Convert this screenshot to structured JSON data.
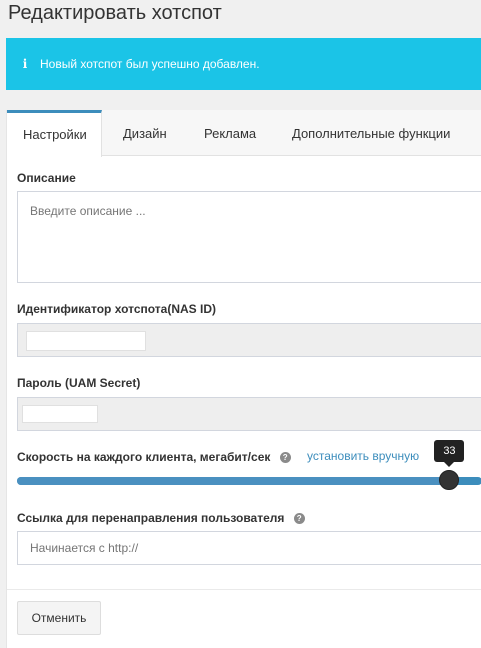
{
  "page": {
    "title": "Редактировать хотспот"
  },
  "alert": {
    "icon": "info-icon",
    "icon_glyph": "i",
    "message": "Новый хотспот был успешно добавлен.",
    "color": "#1bc4e7"
  },
  "tabs": [
    {
      "label": "Настройки",
      "active": true
    },
    {
      "label": "Дизайн",
      "active": false
    },
    {
      "label": "Реклама",
      "active": false
    },
    {
      "label": "Дополнительные функции",
      "active": false
    }
  ],
  "form": {
    "description": {
      "label": "Описание",
      "placeholder": "Введите описание ...",
      "value": ""
    },
    "nas_id": {
      "label": "Идентификатор хотспота(NAS ID)"
    },
    "uam_secret": {
      "label": "Пароль (UAM Secret)"
    },
    "speed": {
      "label": "Скорость на каждого клиента, мегабит/сек",
      "help_glyph": "?",
      "set_manually_link": "установить вручную",
      "value": "33",
      "fraction": 0.93
    },
    "redirect": {
      "label": "Ссылка для перенаправления пользователя",
      "help_glyph": "?",
      "placeholder": "Начинается с http://",
      "value": ""
    }
  },
  "actions": {
    "cancel_label": "Отменить"
  },
  "colors": {
    "accent": "#3c8dbc",
    "alert": "#1bc4e7"
  }
}
